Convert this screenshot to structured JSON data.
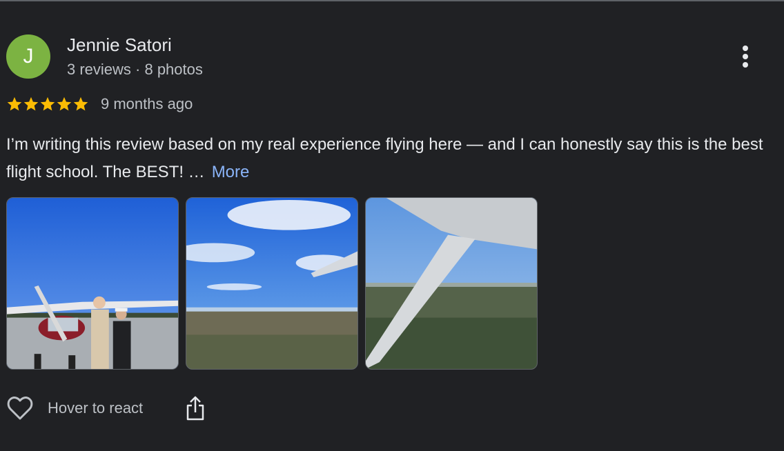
{
  "review": {
    "author": {
      "initial": "J",
      "name": "Jennie Satori",
      "meta": "3 reviews · 8 photos",
      "avatar_color": "#7cb342"
    },
    "rating": 5,
    "rating_max": 5,
    "star_color": "#fbbc04",
    "date": "9 months ago",
    "text": "I’m writing this review based on my real experience flying here — and I can honestly say this is the best flight school. The BEST! …",
    "more_label": "More",
    "link_color": "#8ab4f8",
    "menu_icon": "more-vert-icon",
    "photos": [
      {
        "name": "photo-pilots-with-plane"
      },
      {
        "name": "photo-sky-from-cockpit"
      },
      {
        "name": "photo-wing-strut-aerial-view"
      }
    ],
    "actions": {
      "react_icon": "heart-outline-icon",
      "react_label": "Hover to react",
      "share_icon": "share-icon"
    }
  }
}
